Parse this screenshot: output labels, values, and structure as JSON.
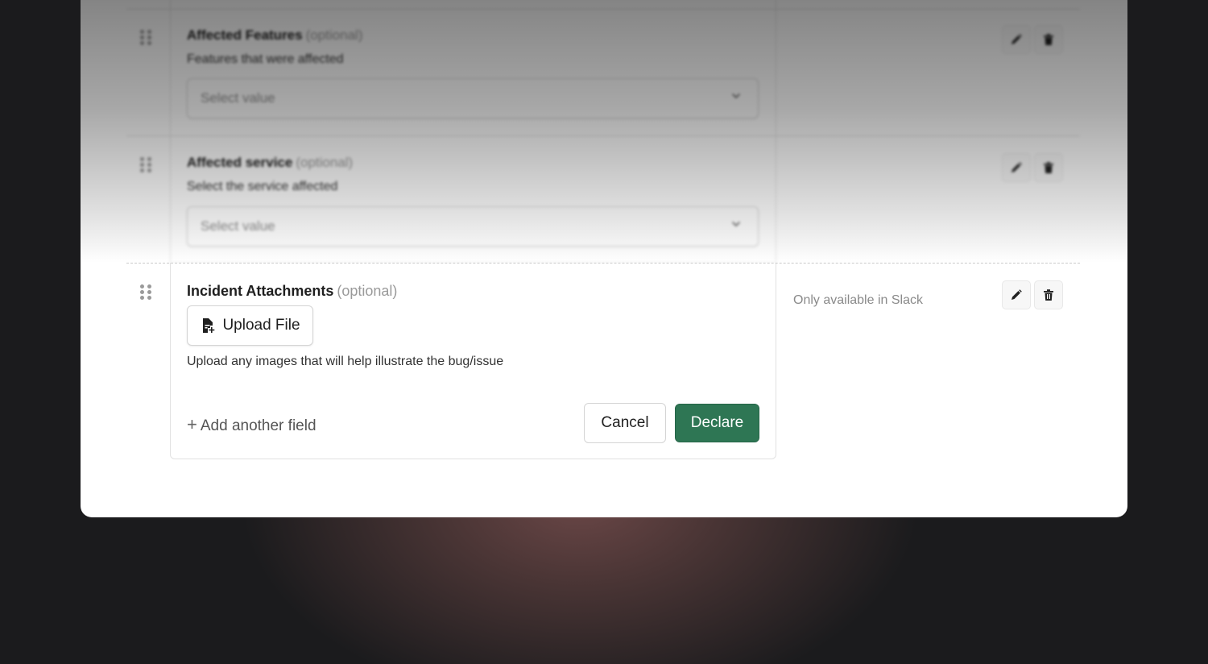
{
  "fields": [
    {
      "title": "Affected Features",
      "optional": "(optional)",
      "description": "Features that were affected",
      "placeholder": "Select value"
    },
    {
      "title": "Affected service",
      "optional": "(optional)",
      "description": "Select the service affected",
      "placeholder": "Select value"
    }
  ],
  "attachments": {
    "title": "Incident Attachments",
    "optional": "(optional)",
    "upload_label": "Upload File",
    "help_text": "Upload any images that will help illustrate the bug/issue",
    "availability_note": "Only available in Slack"
  },
  "footer": {
    "add_field_plus": "+",
    "add_field_label": "Add another field",
    "cancel_label": "Cancel",
    "declare_label": "Declare"
  },
  "colors": {
    "primary": "#2e7654",
    "page_background": "#1b1b1d",
    "panel": "#ffffff"
  },
  "icons": [
    "drag-handle-icon",
    "edit-icon",
    "trash-icon",
    "chevron-down-icon",
    "file-plus-icon"
  ]
}
